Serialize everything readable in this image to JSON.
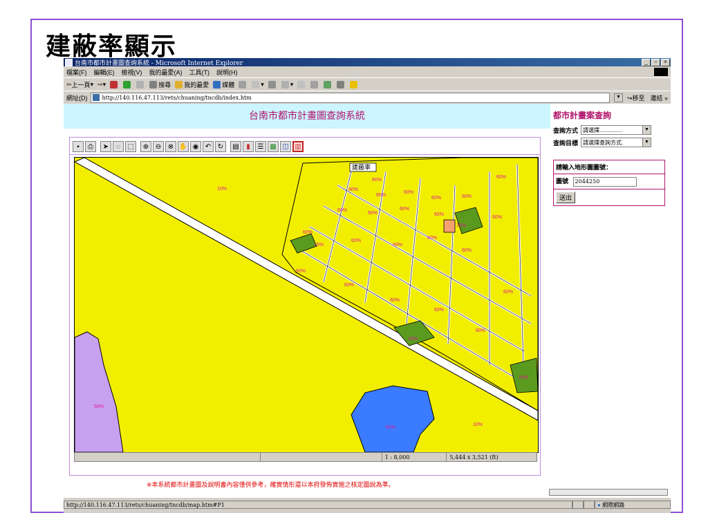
{
  "slide": {
    "title": "建蔽率顯示"
  },
  "window": {
    "title": "台南市都市計畫圖查詢系統 - Microsoft Internet Explorer"
  },
  "menu": [
    "檔案(F)",
    "編輯(E)",
    "檢視(V)",
    "我的最愛(A)",
    "工具(T)",
    "說明(H)"
  ],
  "toolbar": {
    "back": "上一頁",
    "search": "搜尋",
    "favorites": "我的最愛",
    "media": "媒體"
  },
  "address": {
    "label": "網址(D)",
    "url": "http://140.116.47.113/rets/chuaning/tncdb/index.htm",
    "go": "移至",
    "links": "連結"
  },
  "page": {
    "header": "台南市都市計畫圖查詢系統",
    "disclaimer": "※本系統都市計畫圖及說明書內容僅供參考，確實情形還以本府發佈實施之核定圖說為準。"
  },
  "map": {
    "tooltip": "建蔽率",
    "labels": [
      "10%",
      "60%",
      "60%",
      "60%",
      "60%",
      "60%",
      "60%",
      "60%",
      "60%",
      "60%",
      "60%",
      "60%",
      "60%",
      "60%",
      "60%",
      "60%",
      "60%",
      "60%",
      "15%",
      "15%",
      "15%",
      "15%",
      "50%",
      "60%",
      "10%",
      "60%",
      "60%",
      "60%",
      "60%",
      "60%",
      "60%"
    ],
    "scale": "1 : 8,000",
    "extent": "5,444 x 3,521 (ft)"
  },
  "side": {
    "title": "都市計畫案查詢",
    "method_label": "查詢方式",
    "method_value": "請選擇...............",
    "target_label": "查詢目標",
    "target_value": "請選擇查詢方式.",
    "prompt": "請輸入地形圖圖號：",
    "sheet_label": "圖號",
    "sheet_value": "2044250",
    "submit": "送出"
  },
  "status": {
    "url": "http://140.116.47.113/rets/chuaning/tncdb/map.htm#P1",
    "zone": "網際網路"
  },
  "colors": {
    "zone_yellow": "#f2ee00",
    "green": "#5a9a1e",
    "purple": "#c8a0f0",
    "blue": "#3a7bff",
    "label": "#e0169a"
  }
}
